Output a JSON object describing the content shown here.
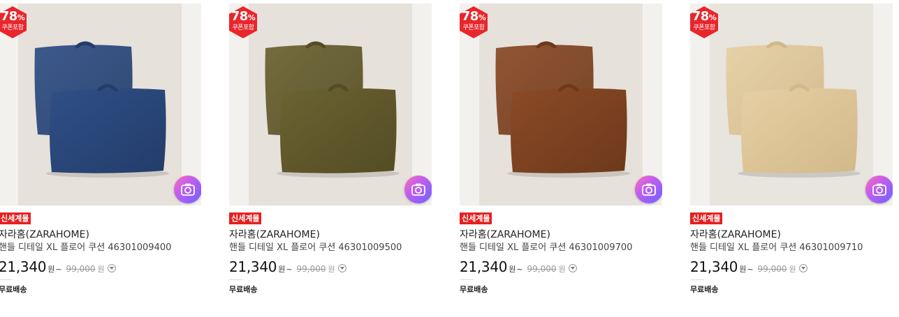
{
  "products": [
    {
      "coupon_pct": "78",
      "coupon_pct_unit": "%",
      "coupon_label": "쿠폰포함",
      "badge": "신세계몰",
      "brand": "자라홈(ZARAHOME)",
      "name": "핸들 디테일 XL 플로어 쿠션 46301009400",
      "price": "21,340",
      "price_unit": "원",
      "price_tilde": "~",
      "original_price": "99,000",
      "original_unit": "원",
      "shipping": "무료배송",
      "pillow_color": "#2f4f86",
      "pillow_shade": "#233d6b",
      "bg_color": "#e6e1da"
    },
    {
      "coupon_pct": "78",
      "coupon_pct_unit": "%",
      "coupon_label": "쿠폰포함",
      "badge": "신세계몰",
      "brand": "자라홈(ZARAHOME)",
      "name": "핸들 디테일 XL 플로어 쿠션 46301009500",
      "price": "21,340",
      "price_unit": "원",
      "price_tilde": "~",
      "original_price": "99,000",
      "original_unit": "원",
      "shipping": "무료배송",
      "pillow_color": "#6b6331",
      "pillow_shade": "#544c24",
      "bg_color": "#e6e1da"
    },
    {
      "coupon_pct": "78",
      "coupon_pct_unit": "%",
      "coupon_label": "쿠폰포함",
      "badge": "신세계몰",
      "brand": "자라홈(ZARAHOME)",
      "name": "핸들 디테일 XL 플로어 쿠션 46301009700",
      "price": "21,340",
      "price_unit": "원",
      "price_tilde": "~",
      "original_price": "99,000",
      "original_unit": "원",
      "shipping": "무료배송",
      "pillow_color": "#8b4a26",
      "pillow_shade": "#6d391c",
      "bg_color": "#e6e1da"
    },
    {
      "coupon_pct": "78",
      "coupon_pct_unit": "%",
      "coupon_label": "쿠폰포함",
      "badge": "신세계몰",
      "brand": "자라홈(ZARAHOME)",
      "name": "핸들 디테일 XL 플로어 쿠션 46301009710",
      "price": "21,340",
      "price_unit": "원",
      "price_tilde": "~",
      "original_price": "99,000",
      "original_unit": "원",
      "shipping": "무료배송",
      "pillow_color": "#e6cfa3",
      "pillow_shade": "#d2b98a",
      "bg_color": "#e8e4de"
    }
  ],
  "colors": {
    "coupon_red": "#e8262c",
    "badge_red": "#e62020"
  },
  "icons": {
    "camera": "camera-search-icon",
    "info": "info-chevron-icon"
  }
}
